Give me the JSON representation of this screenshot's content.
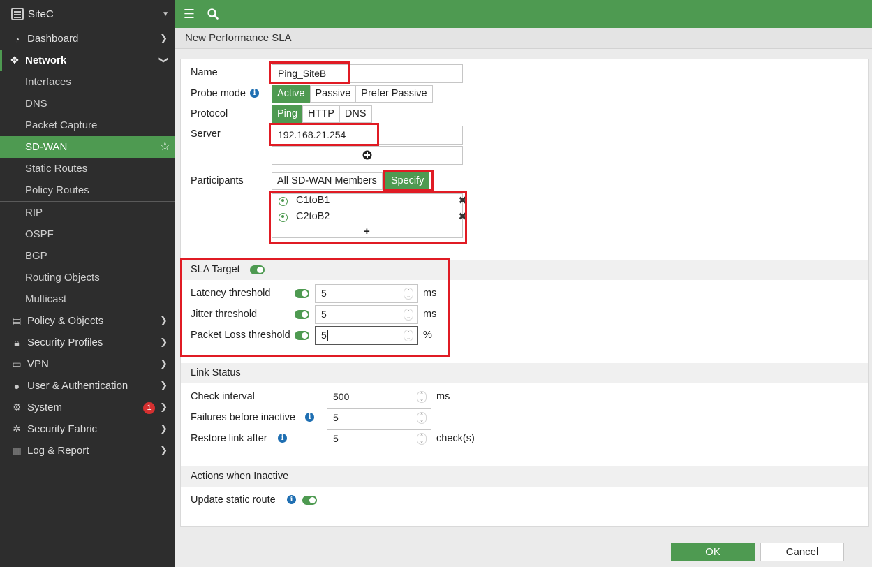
{
  "sidebar": {
    "device": "SiteC",
    "items": [
      {
        "label": "Dashboard"
      },
      {
        "label": "Network"
      },
      {
        "label": "Interfaces"
      },
      {
        "label": "DNS"
      },
      {
        "label": "Packet Capture"
      },
      {
        "label": "SD-WAN"
      },
      {
        "label": "Static Routes"
      },
      {
        "label": "Policy Routes"
      },
      {
        "label": "RIP"
      },
      {
        "label": "OSPF"
      },
      {
        "label": "BGP"
      },
      {
        "label": "Routing Objects"
      },
      {
        "label": "Multicast"
      },
      {
        "label": "Policy & Objects"
      },
      {
        "label": "Security Profiles"
      },
      {
        "label": "VPN"
      },
      {
        "label": "User & Authentication"
      },
      {
        "label": "System",
        "badge": "1"
      },
      {
        "label": "Security Fabric"
      },
      {
        "label": "Log & Report"
      }
    ]
  },
  "page": {
    "title": "New Performance SLA"
  },
  "form": {
    "name_label": "Name",
    "name_value": "Ping_SiteB",
    "probe_mode_label": "Probe mode",
    "probe_modes": [
      "Active",
      "Passive",
      "Prefer Passive"
    ],
    "protocol_label": "Protocol",
    "protocols": [
      "Ping",
      "HTTP",
      "DNS"
    ],
    "server_label": "Server",
    "server_value": "192.168.21.254",
    "participants_label": "Participants",
    "participant_modes": [
      "All SD-WAN Members",
      "Specify"
    ],
    "members": [
      "C1toB1",
      "C2toB2"
    ],
    "add_symbol": "+"
  },
  "sla_target": {
    "title": "SLA Target",
    "latency_label": "Latency threshold",
    "latency_value": "5",
    "latency_unit": "ms",
    "jitter_label": "Jitter threshold",
    "jitter_value": "5",
    "jitter_unit": "ms",
    "loss_label": "Packet Loss threshold",
    "loss_value": "5",
    "loss_unit": "%"
  },
  "link_status": {
    "title": "Link Status",
    "interval_label": "Check interval",
    "interval_value": "500",
    "interval_unit": "ms",
    "failures_label": "Failures before inactive",
    "failures_value": "5",
    "restore_label": "Restore link after",
    "restore_value": "5",
    "restore_unit": "check(s)"
  },
  "actions": {
    "title": "Actions when Inactive",
    "update_route_label": "Update static route"
  },
  "buttons": {
    "ok": "OK",
    "cancel": "Cancel"
  },
  "colors": {
    "accent": "#4e9a51",
    "highlight": "#e01b24",
    "sidebar": "#2d2d2d"
  }
}
